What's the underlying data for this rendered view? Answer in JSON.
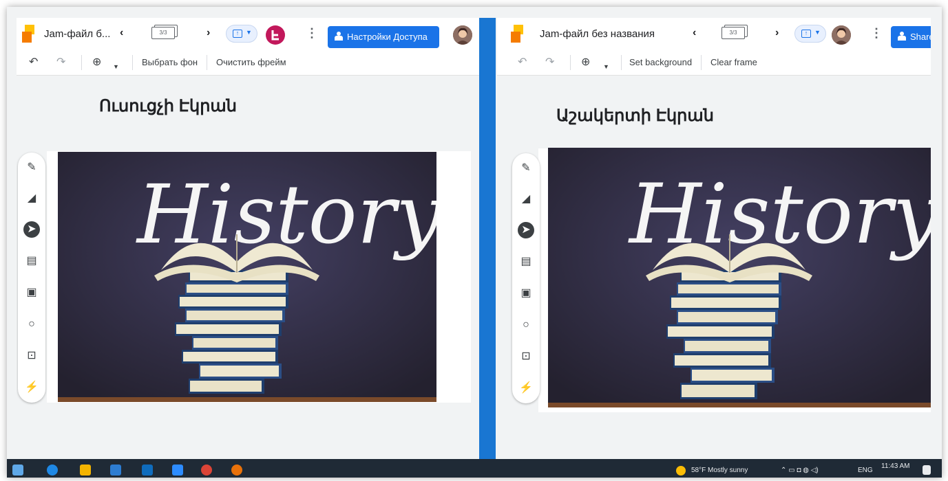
{
  "left_window": {
    "title": "Jam-файл б...",
    "frame_counter": "3/3",
    "share_label": "Настройки Доступа",
    "toolbar": {
      "set_background_label": "Выбрать фон",
      "clear_frame_label": "Очистить фрейм"
    },
    "heading": "Ուսուցչի Էկրան"
  },
  "right_window": {
    "title": "Jam-файл без названия",
    "frame_counter": "3/3",
    "share_label": "Share",
    "toolbar": {
      "set_background_label": "Set background",
      "clear_frame_label": "Clear frame"
    },
    "heading": "Աշակերտի Էկրան"
  },
  "board_image": {
    "word": "History"
  },
  "tools": [
    "pen-icon",
    "eraser-icon",
    "select-pointer-icon",
    "sticky-note-icon",
    "image-icon",
    "shape-circle-icon",
    "text-box-icon",
    "laser-icon"
  ],
  "taskbar": {
    "weather": "58°F  Mostly sunny",
    "language": "ENG",
    "time": "11:43 AM"
  },
  "colors": {
    "accent": "#1a73e8",
    "divider": "#1976d2",
    "chalkboard": "#2f2c43"
  }
}
